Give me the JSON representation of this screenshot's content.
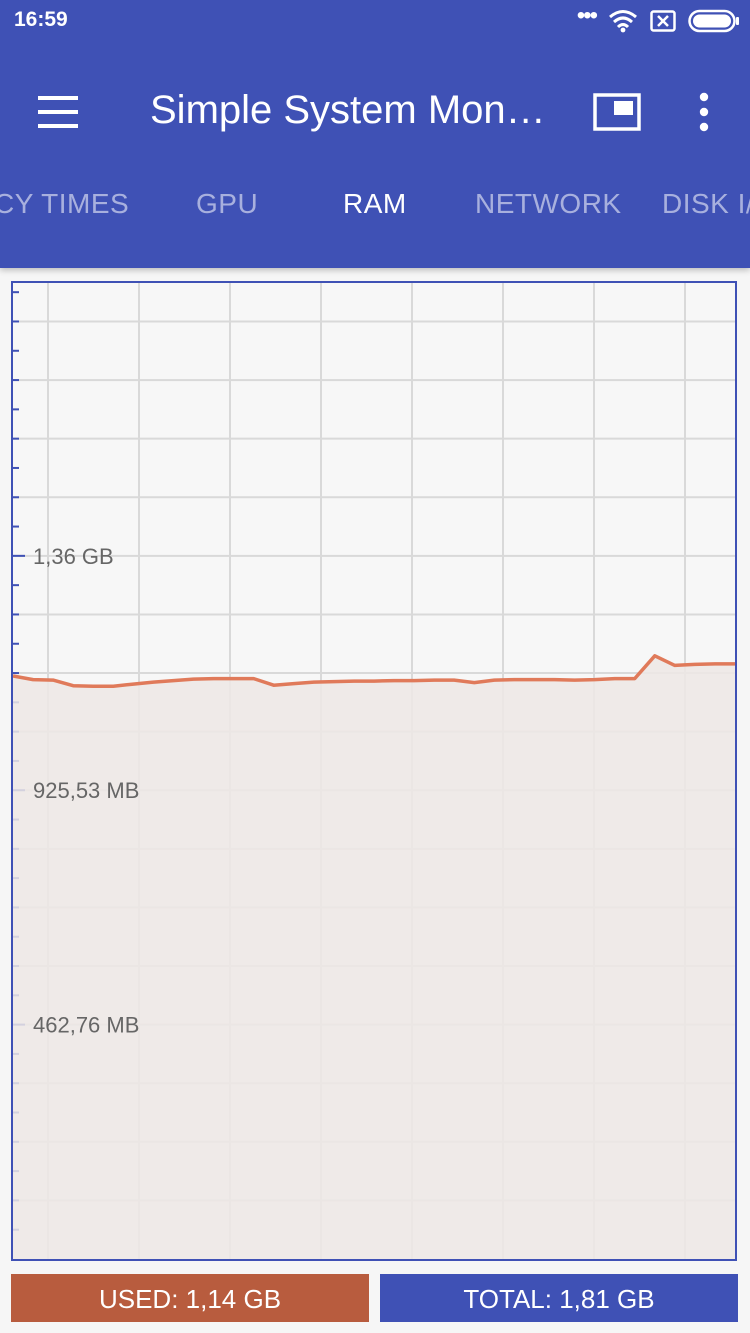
{
  "status_bar": {
    "time": "16:59",
    "icons": [
      "dots-icon",
      "wifi-icon",
      "sim-off-icon",
      "battery-icon"
    ]
  },
  "toolbar": {
    "title": "Simple System Mon…",
    "menu_icon": "hamburger-menu-icon",
    "pip_icon": "picture-in-picture-icon",
    "more_icon": "more-vert-icon"
  },
  "tabs": [
    {
      "label": "CY TIMES",
      "active": false
    },
    {
      "label": "GPU",
      "active": false
    },
    {
      "label": "RAM",
      "active": true
    },
    {
      "label": "NETWORK",
      "active": false
    },
    {
      "label": "DISK I/",
      "active": false
    }
  ],
  "colors": {
    "primary": "#3f51b5",
    "line": "#e07a5a",
    "fill": "#ede8e5",
    "used": "#b85c3e"
  },
  "chart_data": {
    "type": "area",
    "title": "",
    "xlabel": "",
    "ylabel": "",
    "y_tick_labels": [
      "1,36 GB",
      "925,53 MB",
      "462,76 MB"
    ],
    "y_tick_values_mb": [
      1388.3,
      925.53,
      462.76
    ],
    "ylim_mb": [
      0,
      1927
    ],
    "grid": true,
    "series": [
      {
        "values_mb": [
          1151,
          1144,
          1143,
          1132,
          1131,
          1131,
          1135,
          1139,
          1142,
          1145,
          1146,
          1146,
          1146,
          1133,
          1136,
          1139,
          1140,
          1141,
          1141,
          1142,
          1142,
          1143,
          1143,
          1138,
          1143,
          1144,
          1144,
          1144,
          1143,
          1144,
          1146,
          1146,
          1191,
          1172,
          1174,
          1175,
          1175
        ]
      }
    ]
  },
  "footer": {
    "used_label": "USED: 1,14 GB",
    "total_label": "TOTAL: 1,81 GB"
  }
}
